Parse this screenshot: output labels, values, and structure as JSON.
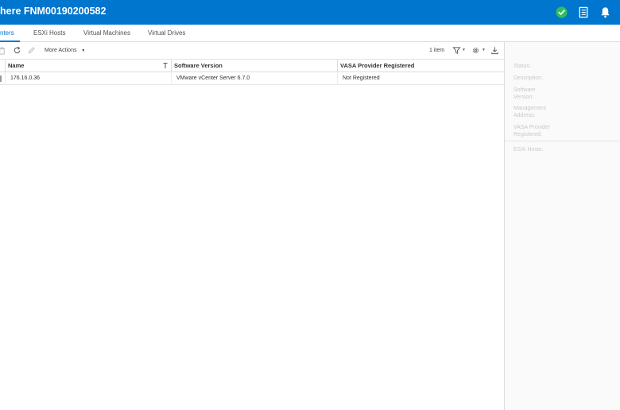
{
  "header": {
    "title": "here FNM00190200582",
    "icons": [
      "check-circle-icon",
      "document-icon",
      "bell-icon"
    ],
    "colors": {
      "background": "#0076ce",
      "success": "#2ebf58"
    }
  },
  "tabs": [
    {
      "label": "nters",
      "active": true
    },
    {
      "label": "ESXi Hosts",
      "active": false
    },
    {
      "label": "Virtual Machines",
      "active": false
    },
    {
      "label": "Virtual Drives",
      "active": false
    }
  ],
  "toolbar": {
    "more_actions_label": "More Actions",
    "item_count": "1 item",
    "icons": [
      "delete-icon",
      "refresh-icon",
      "edit-icon",
      "filter-icon",
      "settings-icon",
      "download-icon"
    ]
  },
  "table": {
    "columns": [
      "Name",
      "Software Version",
      "VASA Provider Registered"
    ],
    "rows": [
      {
        "name": "176.16.0.36",
        "software_version": "VMware vCenter Server 6.7.0",
        "vasa": "Not Registered"
      }
    ]
  },
  "details_panel": {
    "status_label": "Status:",
    "description_label": "Description:",
    "software_version_label_1": "Software",
    "software_version_label_2": "Version:",
    "management_address_label_1": "Management",
    "management_address_label_2": "Address:",
    "vasa_label_1": "VASA Provider",
    "vasa_label_2": "Registered:",
    "esxi_hosts_label": "ESXi Hosts:"
  }
}
